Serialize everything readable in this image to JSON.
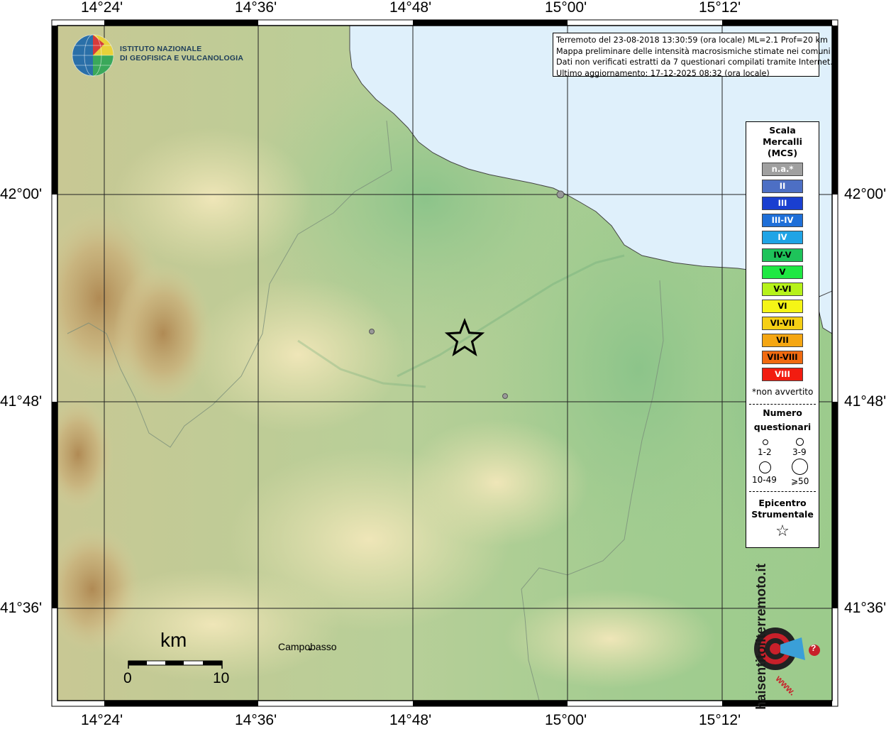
{
  "map": {
    "info_lines": [
      "Terremoto del 23-08-2018 13:30:59 (ora locale) ML=2.1 Prof=20 km",
      "Mappa preliminare delle intensità macrosismiche stimate nei comuni",
      "Dati non verificati estratti da 7 questionari compilati tramite Internet.",
      "Ultimo aggiornamento: 17-12-2025 08:32 (ora locale)"
    ],
    "lon_labels": [
      "14°24'",
      "14°36'",
      "14°48'",
      "15°00'",
      "15°12'"
    ],
    "lat_labels": [
      "42°00'",
      "41°48'",
      "41°36'"
    ],
    "institute": [
      "ISTITUTO NAZIONALE",
      "DI GEOFISICA E VULCANOLOGIA"
    ],
    "city": "Campobasso",
    "scale": {
      "unit": "km",
      "start": "0",
      "end": "10"
    },
    "legend": {
      "title": [
        "Scala",
        "Mercalli",
        "(MCS)"
      ],
      "classes": [
        {
          "label": "n.a.*",
          "color": "#a0a0a0",
          "text_color": "#ffffff"
        },
        {
          "label": "II",
          "color": "#4d6fc4",
          "text_color": "#ffffff"
        },
        {
          "label": "III",
          "color": "#1a3fd0",
          "text_color": "#ffffff"
        },
        {
          "label": "III-IV",
          "color": "#1e6fd8",
          "text_color": "#ffffff"
        },
        {
          "label": "IV",
          "color": "#1fa4e6",
          "text_color": "#ffffff"
        },
        {
          "label": "IV-V",
          "color": "#1ec35a",
          "text_color": "#000000"
        },
        {
          "label": "V",
          "color": "#1fe843",
          "text_color": "#000000"
        },
        {
          "label": "V-VI",
          "color": "#b6f21a",
          "text_color": "#000000"
        },
        {
          "label": "VI",
          "color": "#f5f516",
          "text_color": "#000000"
        },
        {
          "label": "VI-VII",
          "color": "#f5cf14",
          "text_color": "#000000"
        },
        {
          "label": "VII",
          "color": "#f5a612",
          "text_color": "#000000"
        },
        {
          "label": "VII-VIII",
          "color": "#f06a10",
          "text_color": "#000000"
        },
        {
          "label": "VIII",
          "color": "#f21c10",
          "text_color": "#ffffff"
        }
      ],
      "na_note": "*non avvertito",
      "numero_title": [
        "Numero",
        "questionari"
      ],
      "sizes": [
        "1-2",
        "3-9",
        "10-49",
        "⩾50"
      ],
      "epicenter_title": [
        "Epicentro",
        "Strumentale"
      ],
      "star_glyph": "☆"
    },
    "watermark": {
      "brand": "haisentitoilterremoto.it",
      "prefix": "www.",
      "glyph": "?"
    }
  }
}
